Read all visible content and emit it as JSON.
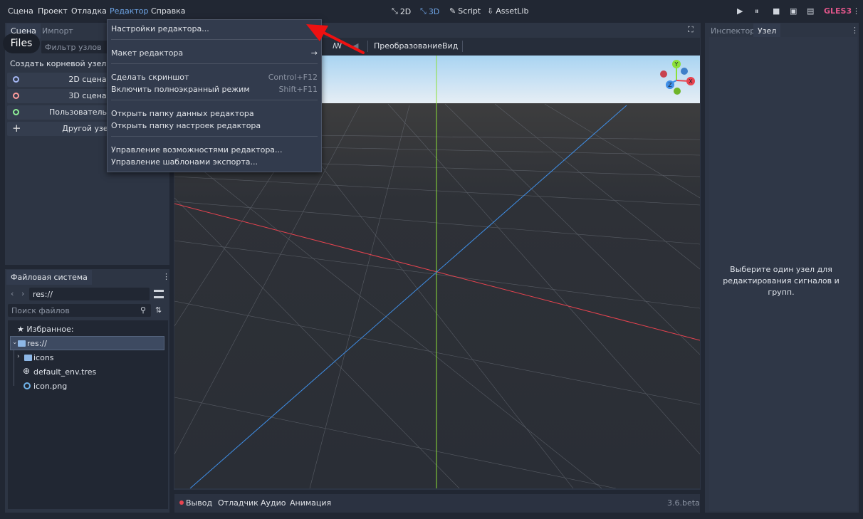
{
  "menubar": {
    "items": [
      "Сцена",
      "Проект",
      "Отладка",
      "Редактор",
      "Справка"
    ],
    "active_index": 3
  },
  "workspaces": {
    "items": [
      {
        "label": "2D",
        "icon": "2d-icon"
      },
      {
        "label": "3D",
        "icon": "3d-icon"
      },
      {
        "label": "Script",
        "icon": "script-icon"
      },
      {
        "label": "AssetLib",
        "icon": "assetlib-icon"
      }
    ],
    "active_index": 1
  },
  "renderer": {
    "label": "GLES3",
    "color": "#e0568a"
  },
  "scene_dock": {
    "tabs": [
      "Сцена",
      "Импорт"
    ],
    "files_tooltip": "Files",
    "filter_placeholder": "Фильтр узлов",
    "create_root_label": "Создать корневой узел:",
    "buttons": [
      {
        "label": "2D сцена",
        "color": "#a5b7f3"
      },
      {
        "label": "3D сцена",
        "color": "#fc9c9c"
      },
      {
        "label": "Пользовательский",
        "color": "#8eef97"
      },
      {
        "label": "Другой узел",
        "color": "#e0e0e0"
      }
    ]
  },
  "filesystem": {
    "tab": "Файловая система",
    "path": "res://",
    "search_placeholder": "Поиск файлов",
    "favorites_label": "Избранное:",
    "tree": [
      {
        "label": "res://",
        "icon": "folder-icon",
        "selected": true
      },
      {
        "label": "icons",
        "icon": "folder-icon"
      },
      {
        "label": "default_env.tres",
        "icon": "environment-icon"
      },
      {
        "label": "icon.png",
        "icon": "image-icon"
      }
    ]
  },
  "editor_menu": {
    "items": [
      {
        "label": "Настройки редактора...",
        "shortcut": ""
      },
      {
        "label": "Макет редактора",
        "shortcut": "",
        "submenu": true
      },
      {
        "label": "Сделать скриншот",
        "shortcut": "Control+F12"
      },
      {
        "label": "Включить полноэкранный режим",
        "shortcut": "Shift+F11"
      },
      {
        "label": "Открыть папку данных редактора",
        "shortcut": ""
      },
      {
        "label": "Открыть папку настроек редактора",
        "shortcut": ""
      },
      {
        "label": "Управление возможностями редактора...",
        "shortcut": ""
      },
      {
        "label": "Управление шаблонами экспорта...",
        "shortcut": ""
      }
    ]
  },
  "viewport": {
    "toolbar": {
      "transform": "Преобразование",
      "view": "Вид"
    },
    "gizmo_axes": [
      "Y",
      "X",
      "Z"
    ]
  },
  "inspector": {
    "tabs": [
      "Инспектор",
      "Узел"
    ],
    "active_index": 1,
    "message": "Выберите один узел для редактирования сигналов и групп."
  },
  "bottom_panel": {
    "items": [
      "Вывод",
      "Отладчик",
      "Аудио",
      "Анимация"
    ],
    "version": "3.6.beta"
  }
}
